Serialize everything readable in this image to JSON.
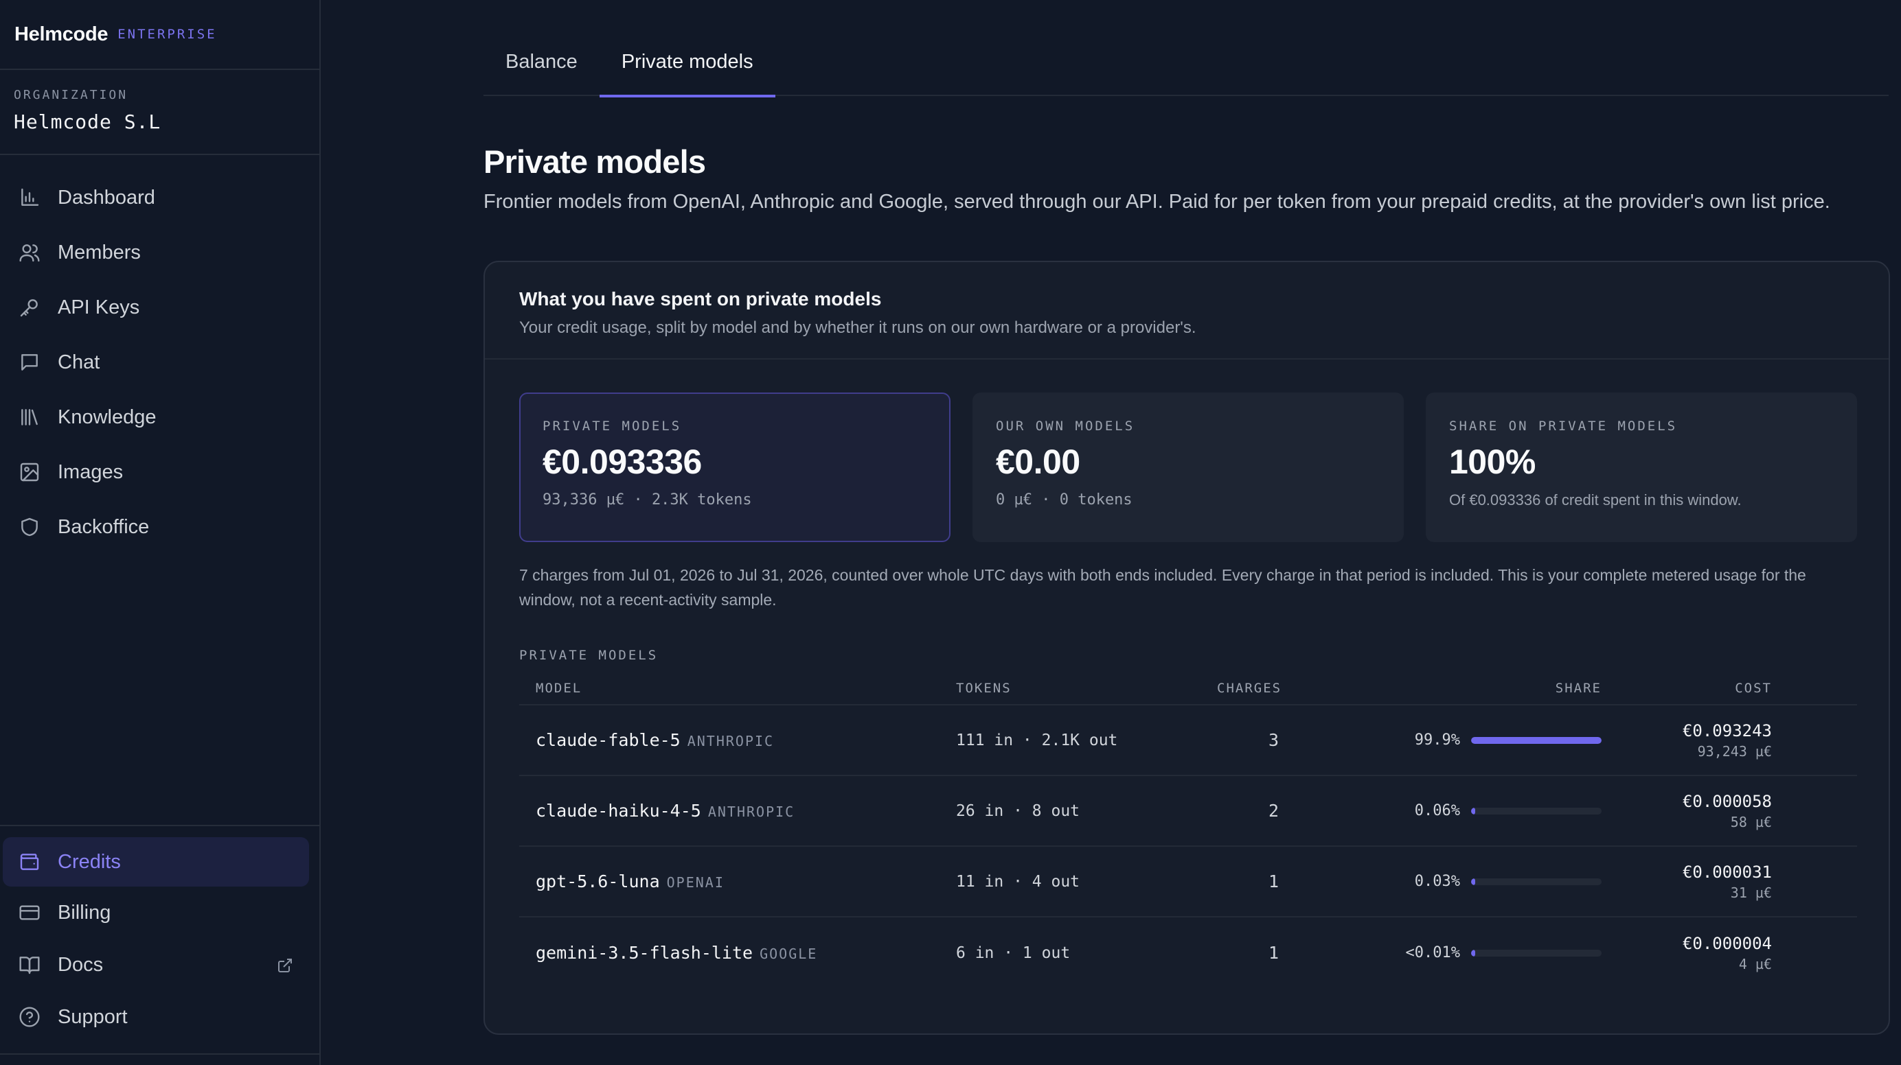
{
  "brand": {
    "name": "Helmcode",
    "tag": "ENTERPRISE"
  },
  "organization": {
    "label": "ORGANIZATION",
    "name": "Helmcode S.L"
  },
  "nav": {
    "items": [
      {
        "label": "Dashboard",
        "icon": "bar-chart-icon"
      },
      {
        "label": "Members",
        "icon": "users-icon"
      },
      {
        "label": "API Keys",
        "icon": "key-icon"
      },
      {
        "label": "Chat",
        "icon": "chat-icon"
      },
      {
        "label": "Knowledge",
        "icon": "library-icon"
      },
      {
        "label": "Images",
        "icon": "image-icon"
      },
      {
        "label": "Backoffice",
        "icon": "shield-icon"
      }
    ],
    "bottom": [
      {
        "label": "Credits",
        "icon": "wallet-icon",
        "active": true
      },
      {
        "label": "Billing",
        "icon": "credit-card-icon"
      },
      {
        "label": "Docs",
        "icon": "book-icon",
        "external": true
      },
      {
        "label": "Support",
        "icon": "help-circle-icon"
      }
    ]
  },
  "tabs": [
    {
      "label": "Balance",
      "active": false
    },
    {
      "label": "Private models",
      "active": true
    }
  ],
  "page": {
    "title": "Private models",
    "subtitle": "Frontier models from OpenAI, Anthropic and Google, served through our API. Paid for per token from your prepaid credits, at the provider's own list price."
  },
  "card": {
    "title": "What you have spent on private models",
    "subtitle": "Your credit usage, split by model and by whether it runs on our own hardware or a provider's."
  },
  "stats": [
    {
      "label": "PRIVATE MODELS",
      "value": "€0.093336",
      "sub": "93,336 µ€ · 2.3K tokens"
    },
    {
      "label": "OUR OWN MODELS",
      "value": "€0.00",
      "sub": "0 µ€ · 0 tokens"
    },
    {
      "label": "SHARE ON PRIVATE MODELS",
      "value": "100%",
      "sub": "Of €0.093336 of credit spent in this window."
    }
  ],
  "note": "7 charges from Jul 01, 2026 to Jul 31, 2026, counted over whole UTC days with both ends included. Every charge in that period is included. This is your complete metered usage for the window, not a recent-activity sample.",
  "table": {
    "section_label": "PRIVATE MODELS",
    "headers": {
      "model": "MODEL",
      "tokens": "TOKENS",
      "charges": "CHARGES",
      "share": "SHARE",
      "cost": "COST"
    },
    "rows": [
      {
        "model": "claude-fable-5",
        "provider": "ANTHROPIC",
        "tokens": "111 in · 2.1K out",
        "charges": "3",
        "share": "99.9%",
        "share_value": 99.9,
        "cost": "€0.093243",
        "cost_micro": "93,243 µ€"
      },
      {
        "model": "claude-haiku-4-5",
        "provider": "ANTHROPIC",
        "tokens": "26 in · 8 out",
        "charges": "2",
        "share": "0.06%",
        "share_value": 0.06,
        "cost": "€0.000058",
        "cost_micro": "58 µ€"
      },
      {
        "model": "gpt-5.6-luna",
        "provider": "OPENAI",
        "tokens": "11 in · 4 out",
        "charges": "1",
        "share": "0.03%",
        "share_value": 0.03,
        "cost": "€0.000031",
        "cost_micro": "31 µ€"
      },
      {
        "model": "gemini-3.5-flash-lite",
        "provider": "GOOGLE",
        "tokens": "6 in · 1 out",
        "charges": "1",
        "share": "<0.01%",
        "share_value": 0.005,
        "cost": "€0.000004",
        "cost_micro": "4 µ€"
      }
    ]
  },
  "colors": {
    "accent": "#7068ee",
    "background": "#111827",
    "card": "#161d2b"
  }
}
